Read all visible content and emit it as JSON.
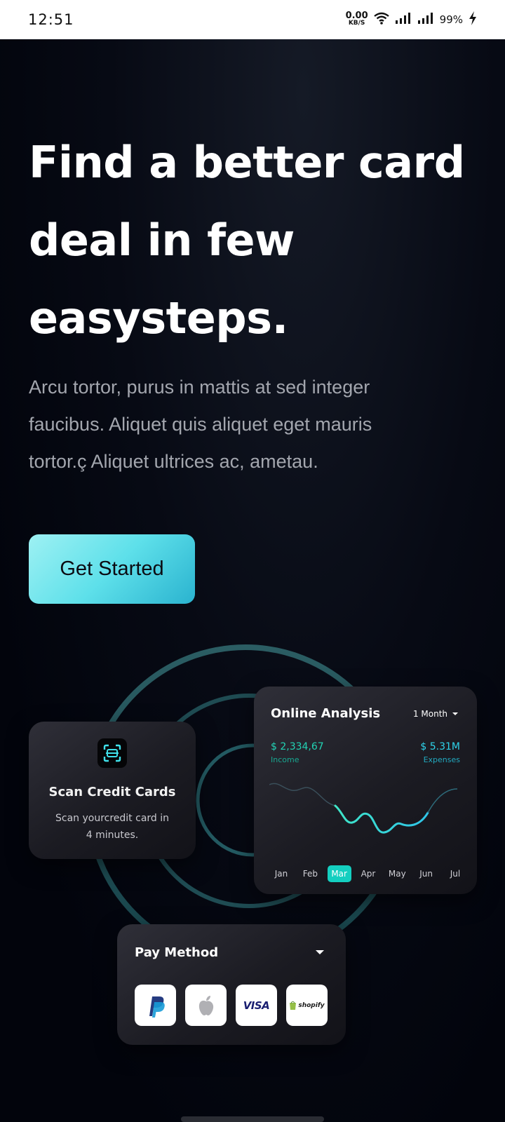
{
  "status_bar": {
    "time": "12:51",
    "net_speed_value": "0.00",
    "net_speed_unit": "KB/S",
    "battery": "99%"
  },
  "hero": {
    "title_lines": [
      "Find a better card",
      "deal in few",
      "easysteps."
    ],
    "subtitle_lines": [
      "Arcu tortor, purus in mattis at sed integer",
      "faucibus. Aliquet quis aliquet eget mauris",
      "tortor.ç Aliquet ultrices ac, ametau."
    ],
    "cta_label": "Get Started"
  },
  "scan_card": {
    "title": "Scan Credit Cards",
    "subtitle_lines": [
      "Scan yourcredit card in",
      "4 minutes."
    ],
    "icon": "scan-icon"
  },
  "analysis_card": {
    "title": "Online Analysis",
    "period": "1 Month",
    "income_value": "$ 2,334,67",
    "income_label": "Income",
    "expenses_value": "$ 5.31M",
    "expenses_label": "Expenses",
    "months": [
      "Jan",
      "Feb",
      "Mar",
      "Apr",
      "May",
      "Jun",
      "Jul"
    ],
    "active_month": "Mar"
  },
  "pay_card": {
    "title": "Pay Method",
    "methods": [
      {
        "name": "paypal-icon"
      },
      {
        "name": "apple-icon"
      },
      {
        "name": "visa-logo",
        "text": "VISA"
      },
      {
        "name": "shopify-logo",
        "text": "shopify"
      }
    ]
  },
  "colors": {
    "accent_cyan": "#5ee0ea",
    "income_green": "#22d3b4",
    "expense_cyan": "#2ed3ea",
    "active_month": "#14cfc0",
    "background": "#02040c"
  }
}
